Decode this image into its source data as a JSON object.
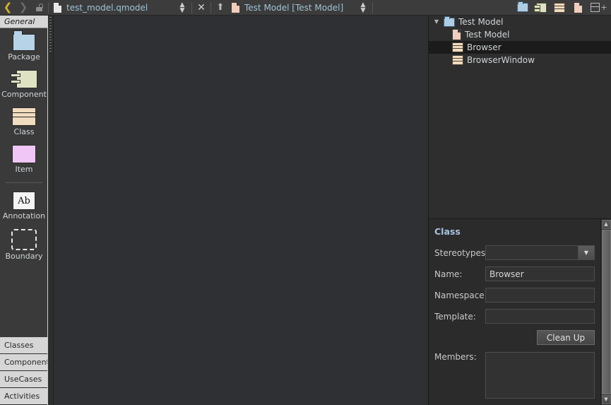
{
  "toolbar": {
    "back_icon": "chevron-left-icon",
    "forward_icon": "chevron-right-icon",
    "lock_icon": "unlocked-padlock-icon",
    "file_path": "test_model.qmodel",
    "model_path": "Test Model [Test Model]",
    "spinner_icon": "up-down-spinner-icon",
    "close_icon": "close-x-icon",
    "up_icon": "arrow-up-icon",
    "create_package_icon": "package-folder-icon",
    "create_component_icon": "component-icon",
    "create_class_icon": "class-icon",
    "create_item_icon": "document-icon",
    "split_icon": "split-view-plus-icon"
  },
  "palette": {
    "active_tab": "General",
    "items": [
      {
        "label": "Package",
        "icon": "package-folder-icon"
      },
      {
        "label": "Component",
        "icon": "component-icon"
      },
      {
        "label": "Class",
        "icon": "class-icon"
      },
      {
        "label": "Item",
        "icon": "item-icon"
      },
      {
        "label": "Annotation",
        "icon": "annotation-ab-icon",
        "glyph": "Ab"
      },
      {
        "label": "Boundary",
        "icon": "boundary-dashed-icon"
      }
    ],
    "tabs": [
      "Classes",
      "Components",
      "UseCases",
      "Activities"
    ]
  },
  "tree": {
    "nodes": [
      {
        "label": "Test Model",
        "icon": "folder-icon",
        "depth": 0,
        "expanded": true,
        "selected": false
      },
      {
        "label": "Test Model",
        "icon": "document-icon",
        "depth": 1,
        "expanded": null,
        "selected": false
      },
      {
        "label": "Browser",
        "icon": "class-icon",
        "depth": 1,
        "expanded": null,
        "selected": true
      },
      {
        "label": "BrowserWindow",
        "icon": "class-icon",
        "depth": 1,
        "expanded": null,
        "selected": false
      }
    ],
    "expand_glyph": "▼"
  },
  "properties": {
    "title": "Class",
    "fields": [
      {
        "label": "Stereotypes:",
        "value": "",
        "type": "combo"
      },
      {
        "label": "Name:",
        "value": "Browser",
        "type": "text"
      },
      {
        "label": "Namespace:",
        "value": "",
        "type": "text"
      },
      {
        "label": "Template:",
        "value": "",
        "type": "text"
      }
    ],
    "clean_up_label": "Clean Up",
    "members_label": "Members:",
    "members_value": "",
    "combo_arrow_glyph": "▼",
    "scroll_up_glyph": "▲",
    "scroll_down_glyph": "▼"
  },
  "colors": {
    "toolbar_bg": "#3c3c3c",
    "canvas_bg": "#2f3033",
    "panel_bg": "#2b2b2b",
    "selection": "#1b1b1b",
    "accent_link": "#9fc3d6",
    "title_accent": "#a8c4e0",
    "nav_active": "#d8b12a"
  }
}
